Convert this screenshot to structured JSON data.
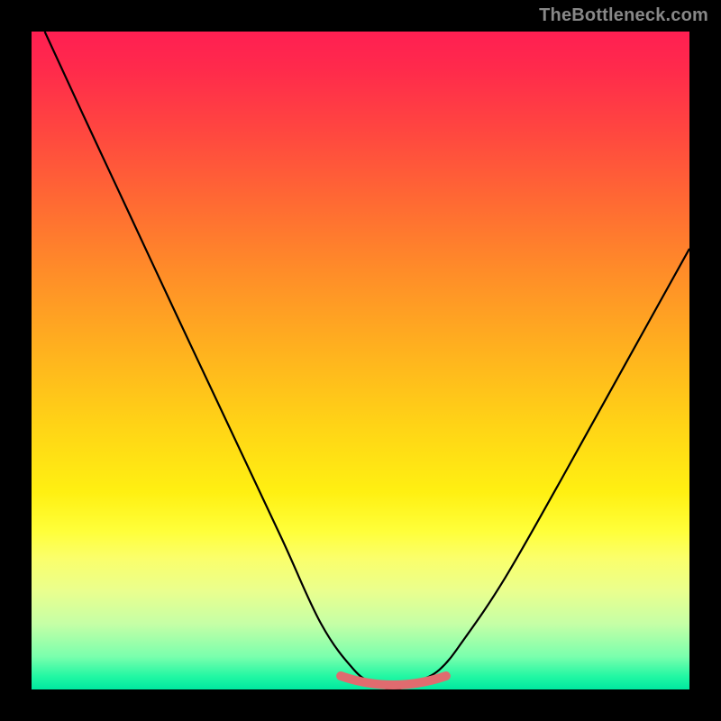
{
  "watermark": {
    "text": "TheBottleneck.com"
  },
  "colors": {
    "curve_stroke": "#000000",
    "bottom_stroke": "#e06b6f",
    "frame": "#000000"
  },
  "chart_data": {
    "type": "line",
    "title": "",
    "xlabel": "",
    "ylabel": "",
    "xlim": [
      0,
      1
    ],
    "ylim": [
      0,
      1
    ],
    "comment": "Bottleneck-style valley curve. Values are normalized: x spans component-match axis 0..1, y is bottleneck% 0..1 (0=no bottleneck at bottom, 1=max near top).",
    "series": [
      {
        "name": "bottleneck-curve",
        "x": [
          0.02,
          0.08,
          0.15,
          0.22,
          0.3,
          0.38,
          0.44,
          0.49,
          0.52,
          0.55,
          0.58,
          0.62,
          0.66,
          0.72,
          0.8,
          0.9,
          1.0
        ],
        "y": [
          1.0,
          0.87,
          0.72,
          0.57,
          0.4,
          0.23,
          0.1,
          0.03,
          0.01,
          0.0,
          0.01,
          0.03,
          0.08,
          0.17,
          0.31,
          0.49,
          0.67
        ]
      }
    ],
    "highlight_floor": {
      "x_start": 0.47,
      "x_end": 0.63,
      "y": 0.015
    }
  }
}
